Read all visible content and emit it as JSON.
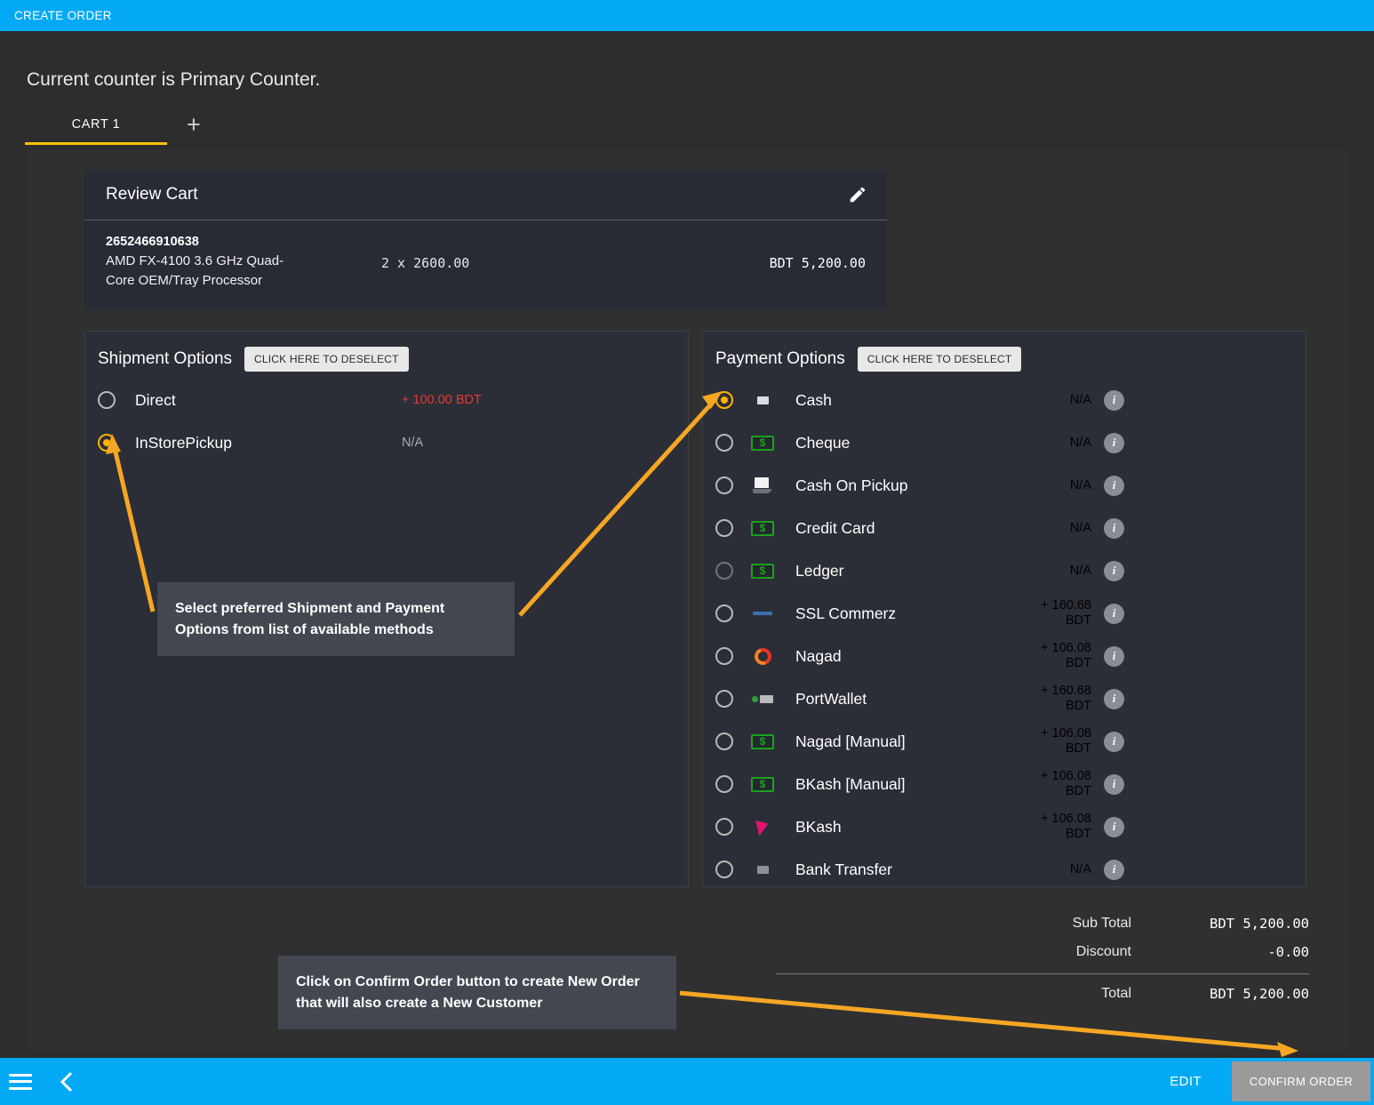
{
  "header": {
    "title": "CREATE ORDER"
  },
  "counter_message": "Current counter is Primary Counter.",
  "tabs": {
    "cart_tab": "CART 1",
    "add_tab": "+"
  },
  "cart": {
    "title": "Review Cart",
    "edit_icon": "pencil-icon",
    "item": {
      "sku": "2652466910638",
      "name": "AMD FX-4100 3.6 GHz Quad-Core OEM/Tray Processor",
      "quantity_price": "2 x  2600.00",
      "line_total": "BDT 5,200.00"
    }
  },
  "shipment": {
    "title": "Shipment Options",
    "deselect_label": "CLICK HERE TO DESELECT",
    "options": [
      {
        "label": "Direct",
        "price": "+ 100.00 BDT",
        "price_type": "fee",
        "selected": false
      },
      {
        "label": "InStorePickup",
        "price": "N/A",
        "price_type": "na",
        "selected": true
      }
    ]
  },
  "payment": {
    "title": "Payment Options",
    "deselect_label": "CLICK HERE TO DESELECT",
    "info_label": "i",
    "options": [
      {
        "label": "Cash",
        "price": "N/A",
        "price_type": "na",
        "selected": true,
        "icon": "card-icon",
        "disabled": false
      },
      {
        "label": "Cheque",
        "price": "N/A",
        "price_type": "na",
        "selected": false,
        "icon": "money-icon",
        "disabled": false
      },
      {
        "label": "Cash On Pickup",
        "price": "N/A",
        "price_type": "na",
        "selected": false,
        "icon": "wallet-hand-icon",
        "disabled": false
      },
      {
        "label": "Credit Card",
        "price": "N/A",
        "price_type": "na",
        "selected": false,
        "icon": "money-icon",
        "disabled": false
      },
      {
        "label": "Ledger",
        "price": "N/A",
        "price_type": "na",
        "selected": false,
        "icon": "money-icon",
        "disabled": true
      },
      {
        "label": "SSL Commerz",
        "price": "+ 160.68 BDT",
        "price_type": "fee",
        "selected": false,
        "icon": "sslcommerz-icon",
        "disabled": false
      },
      {
        "label": "Nagad",
        "price": "+ 106.08 BDT",
        "price_type": "fee",
        "selected": false,
        "icon": "nagad-icon",
        "disabled": false
      },
      {
        "label": "PortWallet",
        "price": "+ 160.68 BDT",
        "price_type": "fee",
        "selected": false,
        "icon": "portwallet-icon",
        "disabled": false
      },
      {
        "label": "Nagad [Manual]",
        "price": "+ 106.08 BDT",
        "price_type": "fee",
        "selected": false,
        "icon": "money-icon",
        "disabled": false
      },
      {
        "label": "BKash [Manual]",
        "price": "+ 106.08 BDT",
        "price_type": "fee",
        "selected": false,
        "icon": "money-icon",
        "disabled": false
      },
      {
        "label": "BKash",
        "price": "+ 106.08 BDT",
        "price_type": "fee",
        "selected": false,
        "icon": "bkash-icon",
        "disabled": false
      },
      {
        "label": "Bank Transfer",
        "price": "N/A",
        "price_type": "na",
        "selected": false,
        "icon": "card-grey-icon",
        "disabled": false
      }
    ]
  },
  "totals": {
    "subtotal_label": "Sub Total",
    "subtotal_value": "BDT 5,200.00",
    "discount_label": "Discount",
    "discount_value": "-0.00",
    "total_label": "Total",
    "total_value": "BDT 5,200.00"
  },
  "callouts": {
    "options": "Select preferred Shipment and Payment Options from list of available methods",
    "confirm": "Click on Confirm Order button to create New Order that will also create a New Customer"
  },
  "bottombar": {
    "menu_icon": "hamburger-icon",
    "back_icon": "chevron-left-icon",
    "edit_label": "EDIT",
    "confirm_label": "CONFIRM ORDER"
  },
  "colors": {
    "accent_blue": "#03a9f4",
    "accent_amber": "#ffc107",
    "fee_red": "#e53935",
    "page_bg": "#2d2d2d",
    "panel_bg": "#282b34",
    "arrow": "#f5a623"
  }
}
